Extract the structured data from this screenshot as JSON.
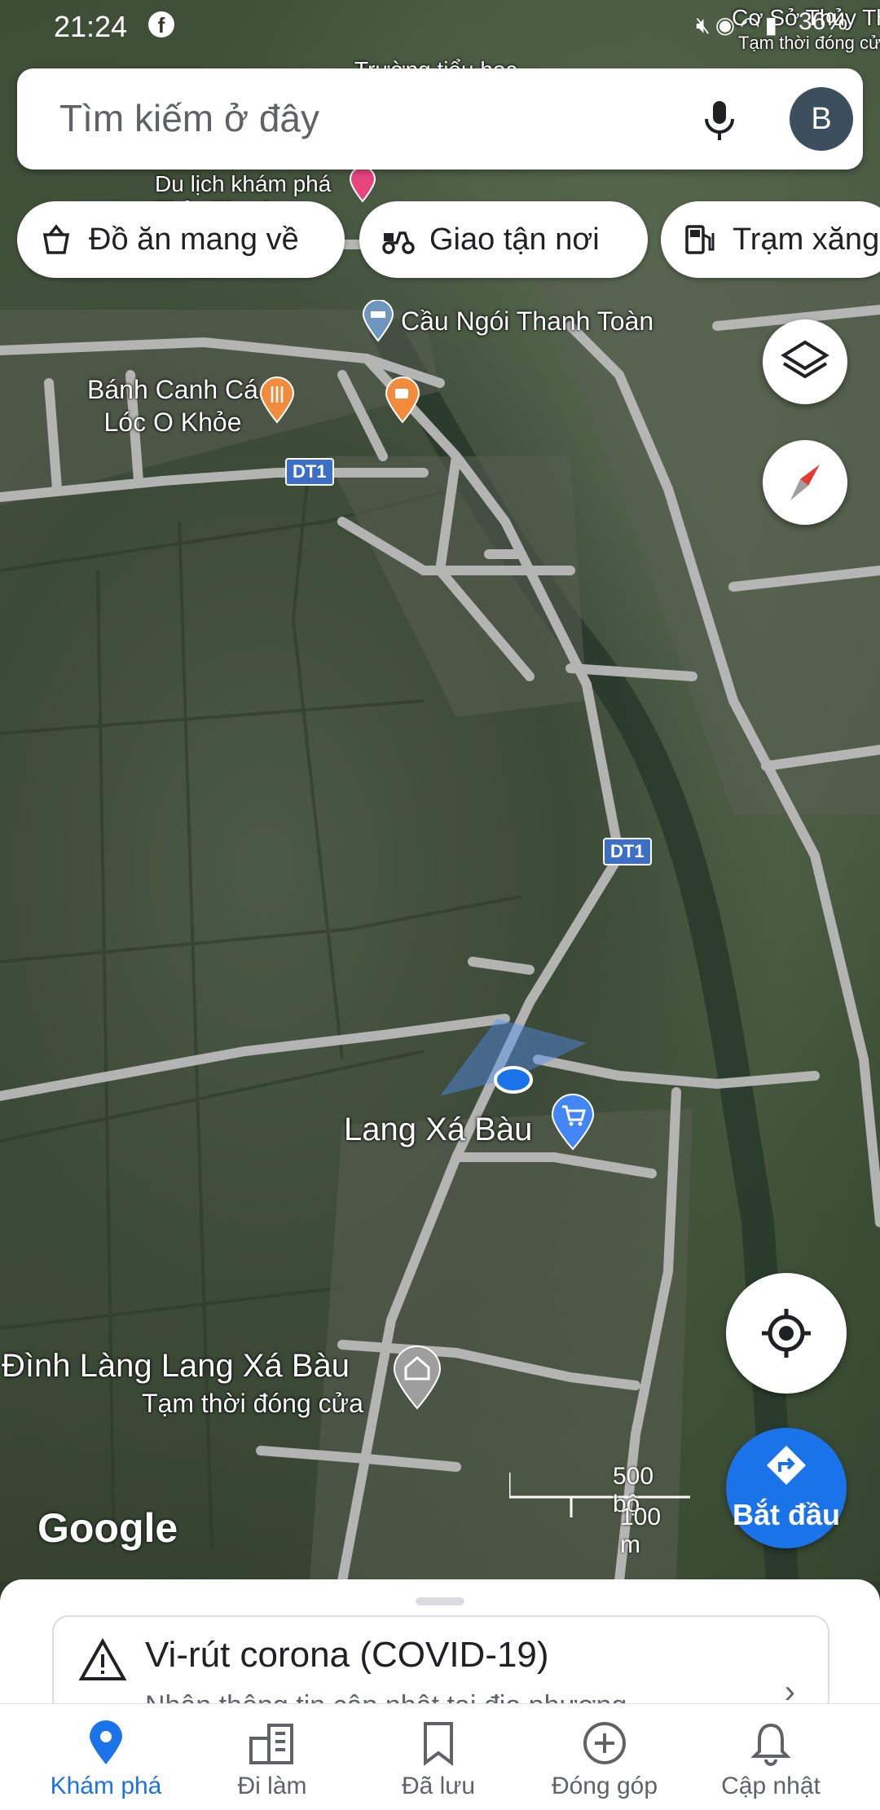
{
  "status_bar": {
    "time": "21:24",
    "facebook_icon": "facebook-icon",
    "battery": "36%"
  },
  "search": {
    "placeholder": "Tìm kiếm ở đây",
    "avatar_letter": "B"
  },
  "chips": [
    {
      "label": "Đồ ăn mang về",
      "icon": "bag-icon"
    },
    {
      "label": "Giao tận nơi",
      "icon": "scooter-icon"
    },
    {
      "label": "Trạm xăng",
      "icon": "gas-station-icon"
    }
  ],
  "map": {
    "labels": {
      "status_place": "Cơ Sở Thủy Thanh",
      "status_place_sub": "Tạm thời đóng cửa",
      "school": "Trường tiểu học",
      "tourism": "Du lịch khám phá Thủy Thanh",
      "bridge": "Cầu Ngói Thanh Toàn",
      "restaurant": "Bánh Canh Cá Lóc O Khỏe",
      "shop": "Lang Xá Bàu",
      "temple": "Đình Làng Lang Xá Bàu",
      "temple_status": "Tạm thời đóng cửa",
      "road_1": "DT1",
      "road_2": "DT1"
    },
    "google_logo": "Google",
    "scale_feet": "500 bộ",
    "scale_meters": "100 m",
    "start_button": "Bắt đầu",
    "colors": {
      "accent": "#1a73e8",
      "food_pin": "#f28b3c",
      "poi_pin": "#e8457f",
      "road": "#bdbdbd"
    }
  },
  "covid_card": {
    "title": "Vi-rút corona (COVID-19)",
    "subtitle": "Nhận thông tin cập nhật tại địa phương"
  },
  "nav": {
    "items": [
      {
        "label": "Khám phá",
        "icon": "location-pin-icon",
        "active": true
      },
      {
        "label": "Đi làm",
        "icon": "office-building-icon",
        "active": false
      },
      {
        "label": "Đã lưu",
        "icon": "bookmark-icon",
        "active": false
      },
      {
        "label": "Đóng góp",
        "icon": "add-circle-icon",
        "active": false
      },
      {
        "label": "Cập nhật",
        "icon": "bell-icon",
        "active": false
      }
    ]
  }
}
